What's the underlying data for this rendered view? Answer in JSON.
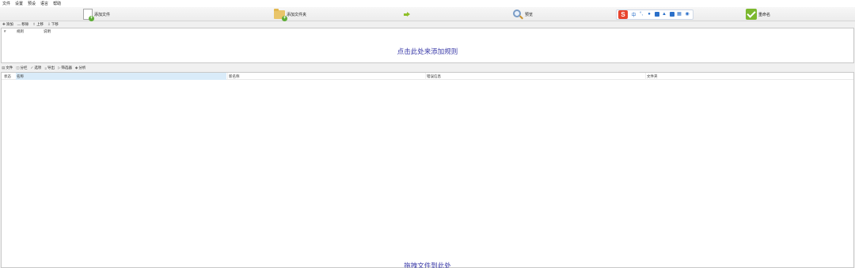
{
  "menu": [
    "文件",
    "设置",
    "预设",
    "语言",
    "帮助"
  ],
  "toolbar": {
    "add_files_label": "添加文件",
    "add_folder_label": "添加文件夹",
    "preview_label": "预览",
    "rename_label": "重命名"
  },
  "ime": {
    "zh_label": "中",
    "punct_label": "°,"
  },
  "rules_toolbar": {
    "add": "添加",
    "remove": "移除",
    "up": "上移",
    "down": "下移"
  },
  "rules_table": {
    "columns": [
      "#",
      "规则",
      "说明"
    ],
    "placeholder": "点击此处来添加规则"
  },
  "files_toolbar": {
    "files": "文件",
    "columns": "分栏",
    "options": "选项",
    "export": "导出",
    "filter": "筛选器",
    "analyze": "分析"
  },
  "files_table": {
    "columns": {
      "status": "状态",
      "name": "名称",
      "new_name": "新名称",
      "error": "错误信息",
      "folder": "文件夹"
    },
    "placeholder": "拖拽文件到此处"
  },
  "colors": {
    "accent_text": "#3a3aa8",
    "selected_header": "#d9ebf9",
    "green_icon": "#5fae37",
    "ime_logo": "#e8442e"
  }
}
